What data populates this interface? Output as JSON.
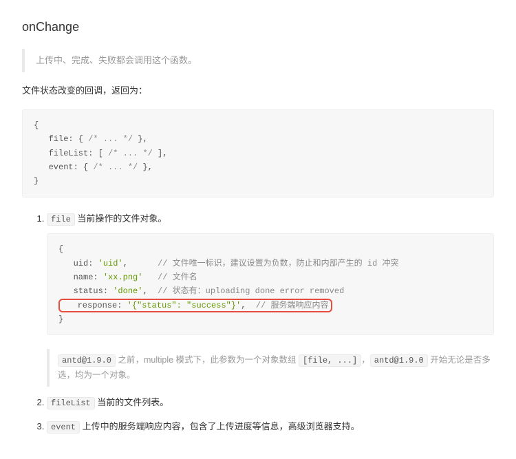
{
  "heading": "onChange",
  "intro_quote": "上传中、完成、失败都会调用这个函数。",
  "intro_para": "文件状态改变的回调，返回为：",
  "code_block_1": {
    "line1a": "{",
    "line2a": "   file",
    "line2b": ": { ",
    "line2c": "/* ... */",
    "line2d": " },",
    "line3a": "   fileList",
    "line3b": ": [ ",
    "line3c": "/* ... */",
    "line3d": " ],",
    "line4a": "   event",
    "line4b": ": { ",
    "line4c": "/* ... */",
    "line4d": " },",
    "line5a": "}"
  },
  "list_item_1": {
    "code": "file",
    "desc": " 当前操作的文件对象。"
  },
  "code_block_2": {
    "l1": "{",
    "l2a": "   uid",
    "l2b": ": ",
    "l2c": "'uid'",
    "l2d": ",      ",
    "l2e": "// 文件唯一标识，建议设置为负数，防止和内部产生的 id 冲突",
    "l3a": "   name",
    "l3b": ": ",
    "l3c": "'xx.png'",
    "l3d": "   ",
    "l3e": "// 文件名",
    "l4a": "   status",
    "l4b": ": ",
    "l4c": "'done'",
    "l4d": ",  ",
    "l4e": "// 状态有：uploading done error removed",
    "l5a": "   response",
    "l5b": ": ",
    "l5c": "'{\"status\": \"success\"}'",
    "l5d": ",  ",
    "l5e": "// 服务端响应内容",
    "l6": "}"
  },
  "version_note": {
    "code_before": "antd@1.9.0",
    "text_mid": " 之前，multiple 模式下，此参数为一个对象数组 ",
    "code_mid": "[file, ...]",
    "text_mid2": "，",
    "code_after": "antd@1.9.0",
    "text_after": " 开始无论是否多选，均为一个对象。"
  },
  "list_item_2": {
    "code": "fileList",
    "desc": " 当前的文件列表。"
  },
  "list_item_3": {
    "code": "event",
    "desc": " 上传中的服务端响应内容，包含了上传进度等信息，高级浏览器支持。"
  }
}
